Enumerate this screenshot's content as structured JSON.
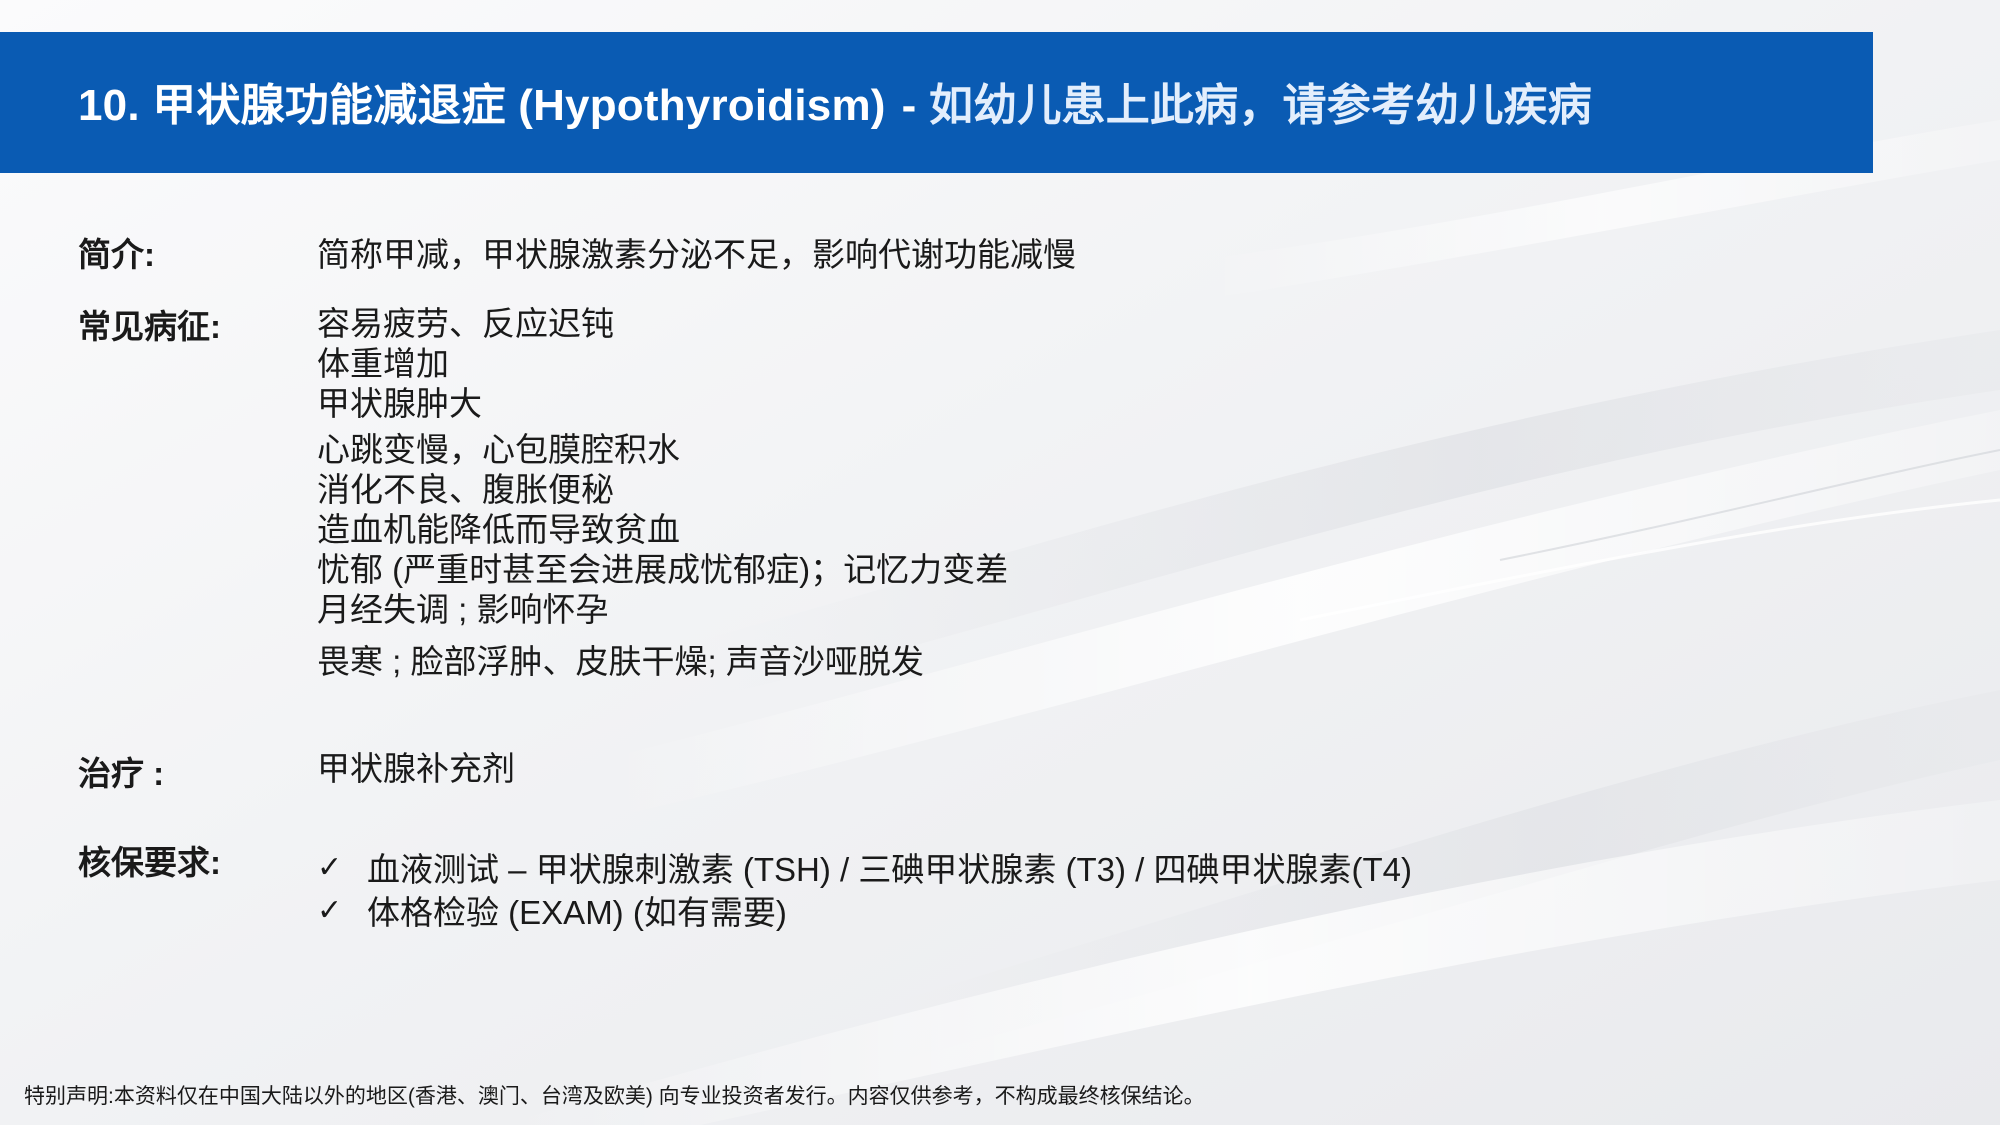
{
  "title": {
    "main": "10. 甲状腺功能减退症 (Hypothyroidism)",
    "separator": "-",
    "sub": "如幼儿患上此病，请参考幼儿疾病"
  },
  "sections": {
    "intro": {
      "label": "简介:",
      "value": "简称甲减，甲状腺激素分泌不足，影响代谢功能减慢"
    },
    "symptoms": {
      "label": "常见病征:",
      "items": [
        "容易疲劳、反应迟钝",
        "体重增加",
        "甲状腺肿大",
        "心跳变慢，心包膜腔积水",
        "消化不良、腹胀便秘",
        "造血机能降低而导致贫血",
        "忧郁 (严重时甚至会进展成忧郁症)；记忆力变差",
        "月经失调 ; 影响怀孕",
        "畏寒 ; 脸部浮肿、皮肤干燥; 声音沙哑脱发"
      ]
    },
    "treatment": {
      "label": "治疗 :",
      "value": "甲状腺补充剂"
    },
    "underwriting": {
      "label": "核保要求:",
      "check_icon": "✓",
      "items": [
        "血液测试 – 甲状腺刺激素 (TSH) / 三碘甲状腺素 (T3) / 四碘甲状腺素(T4)",
        "体格检验 (EXAM) (如有需要)"
      ]
    }
  },
  "disclaimer": "特别声明:本资料仅在中国大陆以外的地区(香港、澳门、台湾及欧美) 向专业投资者发行。内容仅供参考，不构成最终核保结论。",
  "colors": {
    "title_bar": "#0a5bb3",
    "title_text": "#ffffff",
    "body_text": "#1a1a1a",
    "background": "#f6f6f7"
  }
}
